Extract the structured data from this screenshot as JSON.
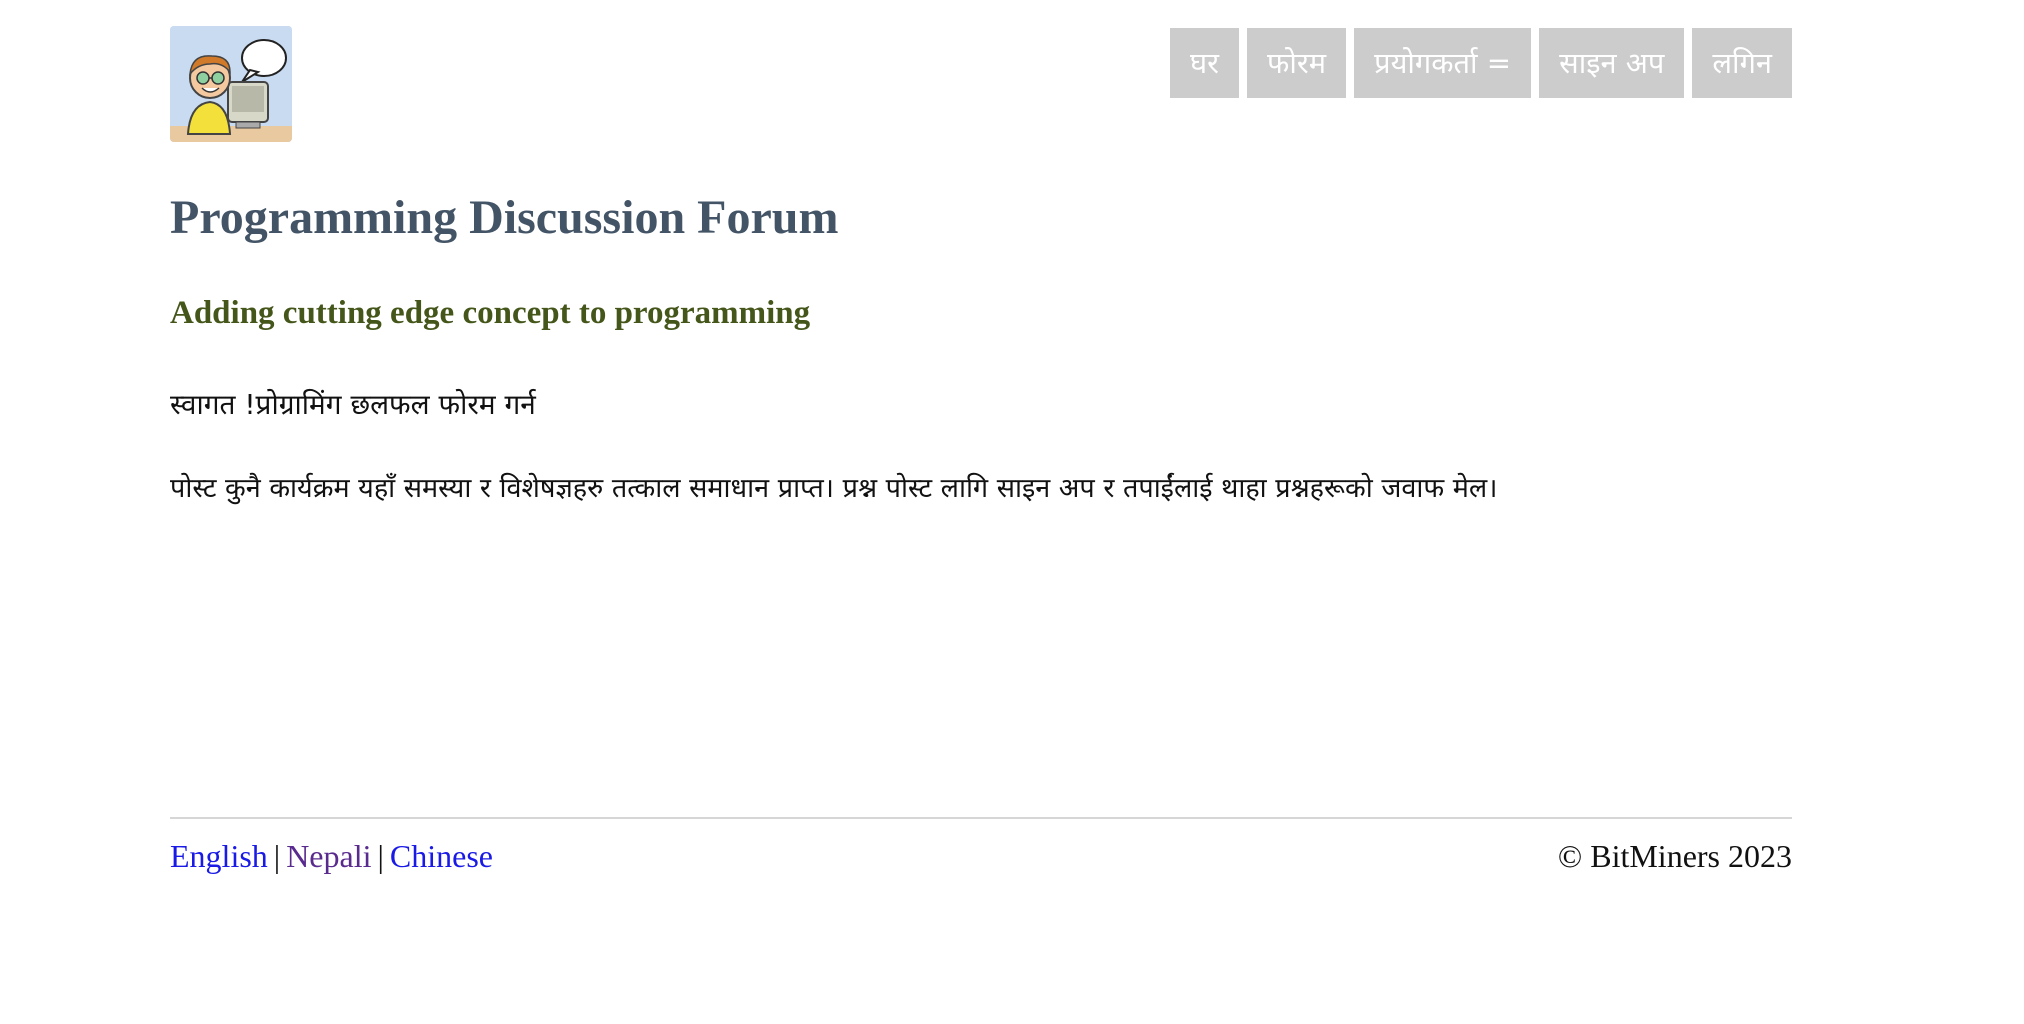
{
  "header": {
    "logo_icon": "programmer-at-computer-logo",
    "nav": [
      {
        "label": "घर"
      },
      {
        "label": "फोरम"
      },
      {
        "label": "प्रयोगकर्ता ="
      },
      {
        "label": "साइन अप"
      },
      {
        "label": "लगिन"
      }
    ]
  },
  "main": {
    "title": "Programming Discussion Forum",
    "tagline": "Adding cutting edge concept to programming",
    "welcome": "स्वागत !प्रोग्रामिंग छलफल फोरम गर्न",
    "intro": "पोस्ट कुनै कार्यक्रम यहाँ समस्या र विशेषज्ञहरु तत्काल समाधान प्राप्त। प्रश्न पोस्ट लागि साइन अप र तपाईंलाई थाहा प्रश्नहरूको जवाफ मेल।"
  },
  "footer": {
    "languages": [
      {
        "label": "English"
      },
      {
        "label": "Nepali"
      },
      {
        "label": "Chinese"
      }
    ],
    "separator": "|",
    "copyright": "© BitMiners 2023"
  },
  "colors": {
    "nav_bg": "#cccccc",
    "title": "#435466",
    "tagline": "#44561a",
    "link": "#1a1ae6",
    "visited_link": "#5a2b8e"
  }
}
